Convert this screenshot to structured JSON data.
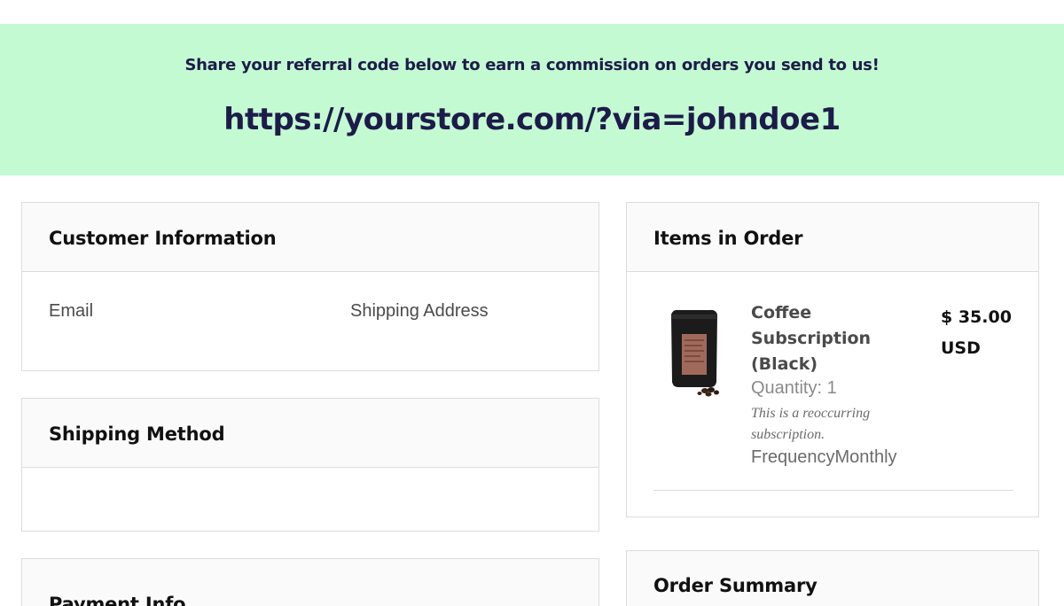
{
  "banner": {
    "message": "Share your referral code below to earn a commission on orders you send to us!",
    "referral_link": "https://yourstore.com/?via=johndoe1"
  },
  "customer_info": {
    "title": "Customer Information",
    "email_label": "Email",
    "shipping_address_label": "Shipping Address"
  },
  "shipping_method": {
    "title": "Shipping Method"
  },
  "payment_info": {
    "title": "Payment Info"
  },
  "items": {
    "title": "Items in Order",
    "list": [
      {
        "name": "Coffee Subscription (Black)",
        "quantity": "Quantity: 1",
        "note": "This is a reoccurring subscription.",
        "frequency": "FrequencyMonthly",
        "price": "$ 35.00 USD",
        "image_icon": "coffee-bag-image"
      }
    ]
  },
  "order_summary": {
    "title": "Order Summary"
  },
  "colors": {
    "banner_bg": "#c4fad2",
    "banner_text": "#1d1b4a",
    "card_border": "#dcdcdc",
    "card_header_bg": "#fafafa"
  }
}
